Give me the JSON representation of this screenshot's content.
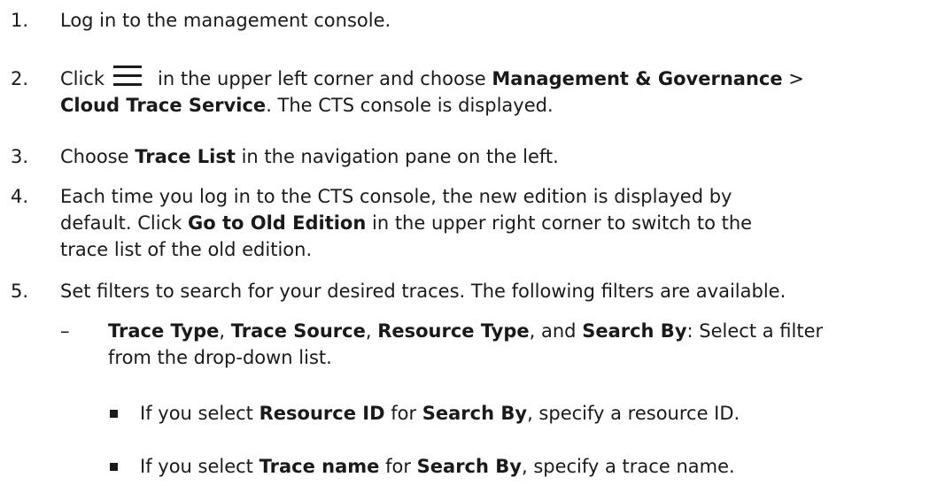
{
  "steps": [
    {
      "number": "1.",
      "text": "Log in to the management console."
    },
    {
      "number": "2.",
      "click": "Click",
      "icon": "menu-icon",
      "mid": "in the upper left corner and choose",
      "bold1": "Management & Governance",
      "sep": ">",
      "bold2": "Cloud Trace Service",
      "tail": ". The CTS console is displayed."
    },
    {
      "number": "3.",
      "pre": "Choose",
      "bold": "Trace List",
      "post": "in the navigation pane on the left."
    },
    {
      "number": "4.",
      "line1": "Each time you log in to the CTS console, the new edition is displayed by",
      "line2_pre": "default. Click",
      "bold": "Go to Old Edition",
      "line2_post": "in the upper right corner to switch to the",
      "line3": "trace list of the old edition."
    },
    {
      "number": "5.",
      "text": "Set filters to search for your desired traces. The following filters are available.",
      "sub": {
        "dash": "–",
        "b1": "Trace Type",
        "c1": ",",
        "b2": "Trace Source",
        "c2": ",",
        "b3": "Resource Type",
        "and": ", and",
        "b4": "Search By",
        "rest": ": Select a filter",
        "line2": "from the drop-down list.",
        "bullets": [
          {
            "pre": "If you select",
            "bold1": "Resource ID",
            "mid": "for",
            "bold2": "Search By",
            "post": ", specify a resource ID."
          },
          {
            "pre": "If you select",
            "bold1": "Trace name",
            "mid": "for",
            "bold2": "Search By",
            "post": ", specify a trace name."
          }
        ]
      }
    }
  ]
}
